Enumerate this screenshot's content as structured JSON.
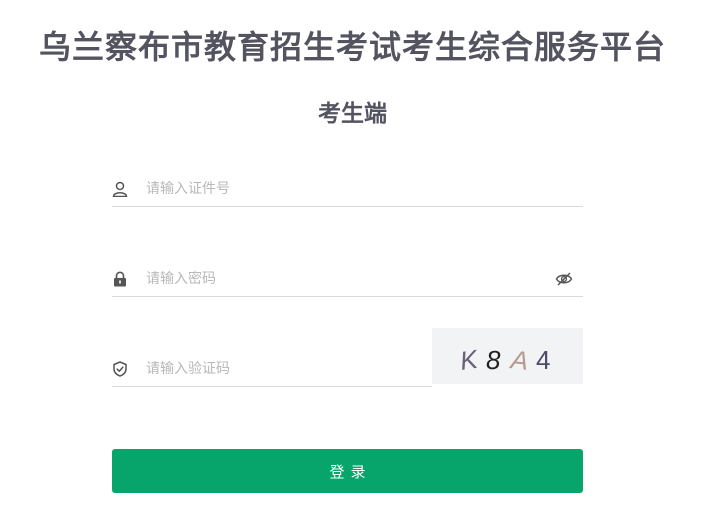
{
  "header": {
    "title": "乌兰察布市教育招生考试考生综合服务平台",
    "subtitle": "考生端"
  },
  "form": {
    "id_field": {
      "placeholder": "请输入证件号",
      "value": "",
      "icon": "user-icon"
    },
    "password_field": {
      "placeholder": "请输入密码",
      "value": "",
      "icon": "lock-icon",
      "toggle_icon": "eye-off-icon"
    },
    "captcha_field": {
      "placeholder": "请输入验证码",
      "value": "",
      "icon": "shield-check-icon"
    },
    "captcha_image": {
      "chars": [
        "K",
        "8",
        "A",
        "4"
      ],
      "colors": [
        "#6b5f7a",
        "#222222",
        "#b8998f",
        "#4a4a6a"
      ]
    },
    "login_label": "登录",
    "login_color": "#07a46b"
  }
}
